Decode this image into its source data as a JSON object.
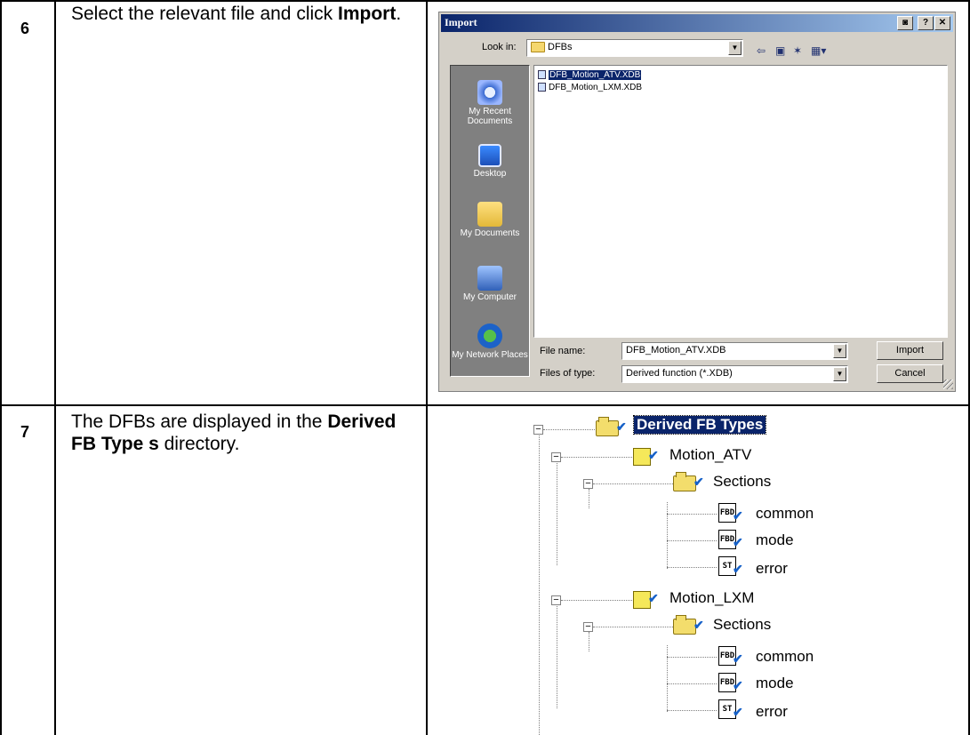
{
  "rows": [
    {
      "number": "6",
      "desc_plain": "Select the relevant file and click ",
      "desc_bold": "Import",
      "desc_tail": "."
    },
    {
      "number": "7",
      "desc_plain": "The DFBs are displayed in the ",
      "desc_bold": "Derived FB Type s",
      "desc_tail": " directory."
    }
  ],
  "dialog": {
    "title": "Import",
    "look_in_label": "Look in:",
    "look_in_value": "DFBs",
    "places": [
      "My Recent Documents",
      "Desktop",
      "My Documents",
      "My Computer",
      "My Network Places"
    ],
    "files": [
      "DFB_Motion_ATV.XDB",
      "DFB_Motion_LXM.XDB"
    ],
    "selected_file": "DFB_Motion_ATV.XDB",
    "file_name_label": "File name:",
    "file_name_value": "DFB_Motion_ATV.XDB",
    "file_type_label": "Files of type:",
    "file_type_value": "Derived function  (*.XDB)",
    "import_button": "Import",
    "cancel_button": "Cancel"
  },
  "tree": {
    "root": "Derived FB Types",
    "types": [
      {
        "name": "Motion_ATV",
        "sections_label": "Sections",
        "sections": [
          {
            "icon": "FBD",
            "name": "common"
          },
          {
            "icon": "FBD",
            "name": "mode"
          },
          {
            "icon": "ST",
            "name": "error"
          }
        ]
      },
      {
        "name": "Motion_LXM",
        "sections_label": "Sections",
        "sections": [
          {
            "icon": "FBD",
            "name": "common"
          },
          {
            "icon": "FBD",
            "name": "mode"
          },
          {
            "icon": "ST",
            "name": "error"
          }
        ]
      }
    ]
  },
  "colors": {
    "title_bar": "#0a246a",
    "selection": "#0a246a",
    "dialog_face": "#d4d0c8"
  }
}
